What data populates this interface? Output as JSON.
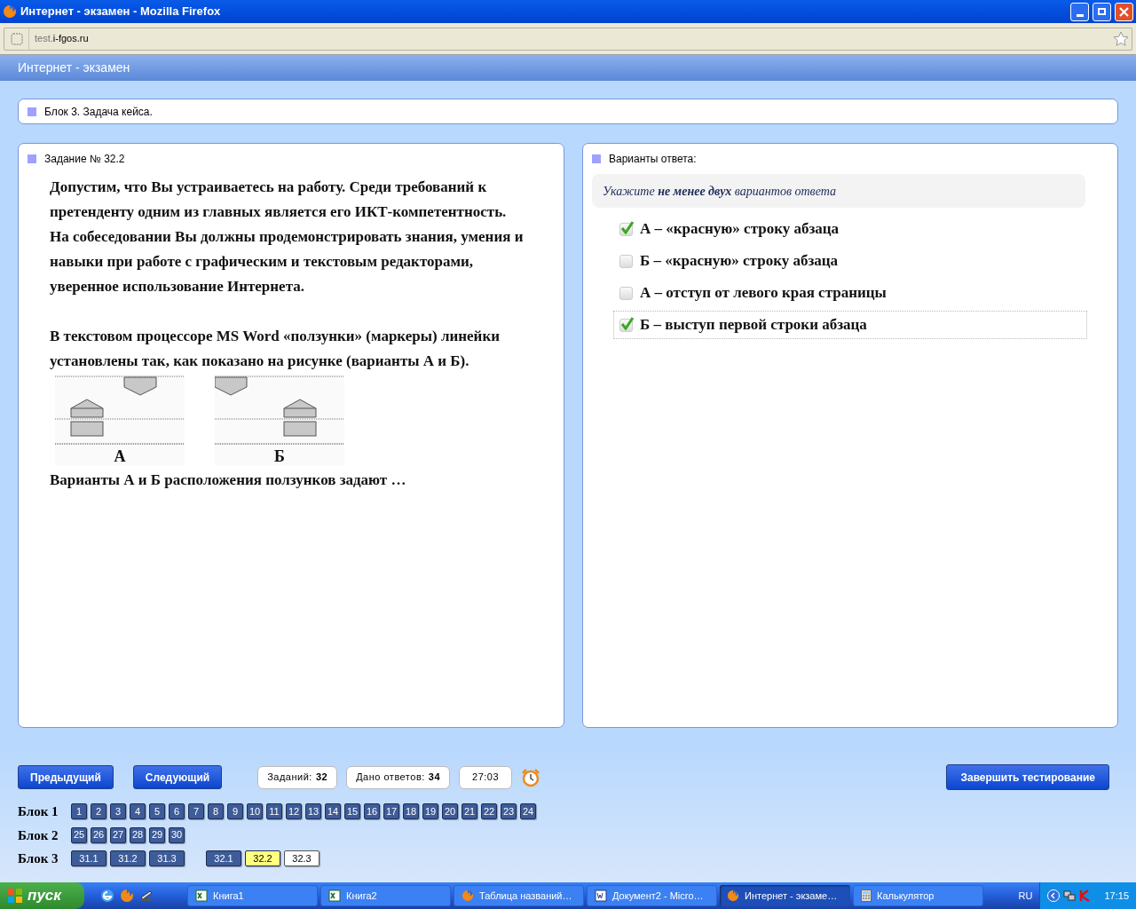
{
  "window": {
    "title": "Интернет - экзамен - Mozilla Firefox"
  },
  "address_bar": {
    "url_prefix": "test.",
    "url_domain": "i-fgos.ru"
  },
  "page_header": "Интернет - экзамен",
  "block_title": "Блок 3. Задача кейса.",
  "task": {
    "heading": "Задание № 32.2",
    "paragraph_groups": [
      [
        "Допустим, что Вы устраиваетесь на работу. Среди требований к претенденту одним из главных является его ИКТ-компетентность.",
        "На собеседовании Вы должны продемонстрировать знания, умения и навыки при работе с графическим и текстовым редакторами, уверенное использование Интернета."
      ],
      [
        "В текстовом процессоре MS Word «ползунки» (маркеры) линейки установлены так, как показано на рисунке (варианты А и Б)."
      ]
    ],
    "figure_labels": [
      "А",
      "Б"
    ],
    "question": "Варианты А и Б расположения ползунков задают …"
  },
  "answers": {
    "heading": "Варианты ответа:",
    "hint": "Укажите **не менее двух** вариантов ответа",
    "options": [
      {
        "label": "А – «красную» строку абзаца",
        "checked": true,
        "focused": false
      },
      {
        "label": "Б – «красную» строку абзаца",
        "checked": false,
        "focused": false
      },
      {
        "label": "А – отступ от левого края страницы",
        "checked": false,
        "focused": false
      },
      {
        "label": "Б – выступ первой строки абзаца",
        "checked": true,
        "focused": true
      }
    ]
  },
  "nav": {
    "buttons": [
      "Предыдущий",
      "Следующий"
    ],
    "counters": [
      {
        "label": "Заданий:",
        "value": "32"
      },
      {
        "label": "Дано ответов:",
        "value": "34"
      }
    ],
    "timer": "27:03",
    "finish": "Завершить тестирование"
  },
  "blocks": [
    {
      "label": "Блок 1",
      "groups": [
        [
          {
            "label": "1",
            "answered": true,
            "selected": false
          },
          {
            "label": "2",
            "answered": true,
            "selected": false
          },
          {
            "label": "3",
            "answered": true,
            "selected": false
          },
          {
            "label": "4",
            "answered": true,
            "selected": false
          },
          {
            "label": "5",
            "answered": true,
            "selected": false
          },
          {
            "label": "6",
            "answered": true,
            "selected": false
          },
          {
            "label": "7",
            "answered": true,
            "selected": false
          },
          {
            "label": "8",
            "answered": true,
            "selected": false
          },
          {
            "label": "9",
            "answered": true,
            "selected": false
          },
          {
            "label": "10",
            "answered": true,
            "selected": false
          },
          {
            "label": "11",
            "answered": true,
            "selected": false
          },
          {
            "label": "12",
            "answered": true,
            "selected": false
          },
          {
            "label": "13",
            "answered": true,
            "selected": false
          },
          {
            "label": "14",
            "answered": true,
            "selected": false
          },
          {
            "label": "15",
            "answered": true,
            "selected": false
          },
          {
            "label": "16",
            "answered": true,
            "selected": false
          },
          {
            "label": "17",
            "answered": true,
            "selected": false
          },
          {
            "label": "18",
            "answered": true,
            "selected": false
          },
          {
            "label": "19",
            "answered": true,
            "selected": false
          },
          {
            "label": "20",
            "answered": true,
            "selected": false
          },
          {
            "label": "21",
            "answered": true,
            "selected": false
          },
          {
            "label": "22",
            "answered": true,
            "selected": false
          },
          {
            "label": "23",
            "answered": true,
            "selected": false
          },
          {
            "label": "24",
            "answered": true,
            "selected": false
          }
        ]
      ]
    },
    {
      "label": "Блок 2",
      "groups": [
        [
          {
            "label": "25",
            "answered": true,
            "selected": false
          },
          {
            "label": "26",
            "answered": true,
            "selected": false
          },
          {
            "label": "27",
            "answered": true,
            "selected": false
          },
          {
            "label": "28",
            "answered": true,
            "selected": false
          },
          {
            "label": "29",
            "answered": true,
            "selected": false
          },
          {
            "label": "30",
            "answered": true,
            "selected": false
          }
        ]
      ]
    },
    {
      "label": "Блок 3",
      "groups": [
        [
          {
            "label": "31.1",
            "answered": true,
            "selected": false
          },
          {
            "label": "31.2",
            "answered": true,
            "selected": false
          },
          {
            "label": "31.3",
            "answered": true,
            "selected": false
          }
        ],
        [
          {
            "label": "32.1",
            "answered": true,
            "selected": false
          },
          {
            "label": "32.2",
            "answered": true,
            "selected": true
          },
          {
            "label": "32.3",
            "answered": false,
            "selected": false
          }
        ]
      ]
    }
  ],
  "taskbar": {
    "start": "пуск",
    "tasks": [
      {
        "label": "Книга1",
        "kind": "excel",
        "selected": false
      },
      {
        "label": "Книга2",
        "kind": "excel",
        "selected": false
      },
      {
        "label": "Таблица названий…",
        "kind": "firefox",
        "selected": false
      },
      {
        "label": "Документ2 - Micro…",
        "kind": "word",
        "selected": false
      },
      {
        "label": "Интернет - экзаме…",
        "kind": "firefox",
        "selected": true
      },
      {
        "label": "Калькулятор",
        "kind": "calc",
        "selected": false
      }
    ],
    "language": "RU",
    "time": "17:15"
  }
}
